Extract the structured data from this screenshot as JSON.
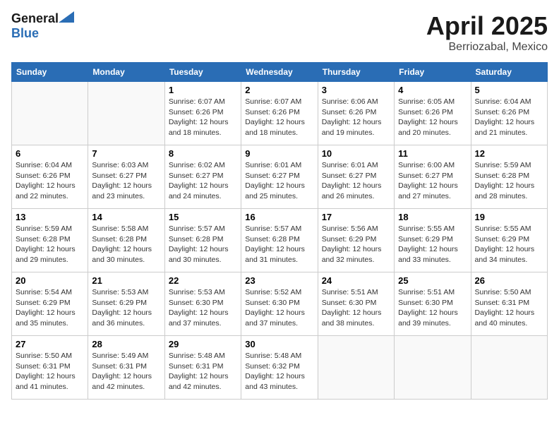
{
  "header": {
    "logo_general": "General",
    "logo_blue": "Blue",
    "title": "April 2025",
    "location": "Berriozabal, Mexico"
  },
  "weekdays": [
    "Sunday",
    "Monday",
    "Tuesday",
    "Wednesday",
    "Thursday",
    "Friday",
    "Saturday"
  ],
  "weeks": [
    [
      {
        "day": "",
        "sunrise": "",
        "sunset": "",
        "daylight": ""
      },
      {
        "day": "",
        "sunrise": "",
        "sunset": "",
        "daylight": ""
      },
      {
        "day": "1",
        "sunrise": "Sunrise: 6:07 AM",
        "sunset": "Sunset: 6:26 PM",
        "daylight": "Daylight: 12 hours and 18 minutes."
      },
      {
        "day": "2",
        "sunrise": "Sunrise: 6:07 AM",
        "sunset": "Sunset: 6:26 PM",
        "daylight": "Daylight: 12 hours and 18 minutes."
      },
      {
        "day": "3",
        "sunrise": "Sunrise: 6:06 AM",
        "sunset": "Sunset: 6:26 PM",
        "daylight": "Daylight: 12 hours and 19 minutes."
      },
      {
        "day": "4",
        "sunrise": "Sunrise: 6:05 AM",
        "sunset": "Sunset: 6:26 PM",
        "daylight": "Daylight: 12 hours and 20 minutes."
      },
      {
        "day": "5",
        "sunrise": "Sunrise: 6:04 AM",
        "sunset": "Sunset: 6:26 PM",
        "daylight": "Daylight: 12 hours and 21 minutes."
      }
    ],
    [
      {
        "day": "6",
        "sunrise": "Sunrise: 6:04 AM",
        "sunset": "Sunset: 6:26 PM",
        "daylight": "Daylight: 12 hours and 22 minutes."
      },
      {
        "day": "7",
        "sunrise": "Sunrise: 6:03 AM",
        "sunset": "Sunset: 6:27 PM",
        "daylight": "Daylight: 12 hours and 23 minutes."
      },
      {
        "day": "8",
        "sunrise": "Sunrise: 6:02 AM",
        "sunset": "Sunset: 6:27 PM",
        "daylight": "Daylight: 12 hours and 24 minutes."
      },
      {
        "day": "9",
        "sunrise": "Sunrise: 6:01 AM",
        "sunset": "Sunset: 6:27 PM",
        "daylight": "Daylight: 12 hours and 25 minutes."
      },
      {
        "day": "10",
        "sunrise": "Sunrise: 6:01 AM",
        "sunset": "Sunset: 6:27 PM",
        "daylight": "Daylight: 12 hours and 26 minutes."
      },
      {
        "day": "11",
        "sunrise": "Sunrise: 6:00 AM",
        "sunset": "Sunset: 6:27 PM",
        "daylight": "Daylight: 12 hours and 27 minutes."
      },
      {
        "day": "12",
        "sunrise": "Sunrise: 5:59 AM",
        "sunset": "Sunset: 6:28 PM",
        "daylight": "Daylight: 12 hours and 28 minutes."
      }
    ],
    [
      {
        "day": "13",
        "sunrise": "Sunrise: 5:59 AM",
        "sunset": "Sunset: 6:28 PM",
        "daylight": "Daylight: 12 hours and 29 minutes."
      },
      {
        "day": "14",
        "sunrise": "Sunrise: 5:58 AM",
        "sunset": "Sunset: 6:28 PM",
        "daylight": "Daylight: 12 hours and 30 minutes."
      },
      {
        "day": "15",
        "sunrise": "Sunrise: 5:57 AM",
        "sunset": "Sunset: 6:28 PM",
        "daylight": "Daylight: 12 hours and 30 minutes."
      },
      {
        "day": "16",
        "sunrise": "Sunrise: 5:57 AM",
        "sunset": "Sunset: 6:28 PM",
        "daylight": "Daylight: 12 hours and 31 minutes."
      },
      {
        "day": "17",
        "sunrise": "Sunrise: 5:56 AM",
        "sunset": "Sunset: 6:29 PM",
        "daylight": "Daylight: 12 hours and 32 minutes."
      },
      {
        "day": "18",
        "sunrise": "Sunrise: 5:55 AM",
        "sunset": "Sunset: 6:29 PM",
        "daylight": "Daylight: 12 hours and 33 minutes."
      },
      {
        "day": "19",
        "sunrise": "Sunrise: 5:55 AM",
        "sunset": "Sunset: 6:29 PM",
        "daylight": "Daylight: 12 hours and 34 minutes."
      }
    ],
    [
      {
        "day": "20",
        "sunrise": "Sunrise: 5:54 AM",
        "sunset": "Sunset: 6:29 PM",
        "daylight": "Daylight: 12 hours and 35 minutes."
      },
      {
        "day": "21",
        "sunrise": "Sunrise: 5:53 AM",
        "sunset": "Sunset: 6:29 PM",
        "daylight": "Daylight: 12 hours and 36 minutes."
      },
      {
        "day": "22",
        "sunrise": "Sunrise: 5:53 AM",
        "sunset": "Sunset: 6:30 PM",
        "daylight": "Daylight: 12 hours and 37 minutes."
      },
      {
        "day": "23",
        "sunrise": "Sunrise: 5:52 AM",
        "sunset": "Sunset: 6:30 PM",
        "daylight": "Daylight: 12 hours and 37 minutes."
      },
      {
        "day": "24",
        "sunrise": "Sunrise: 5:51 AM",
        "sunset": "Sunset: 6:30 PM",
        "daylight": "Daylight: 12 hours and 38 minutes."
      },
      {
        "day": "25",
        "sunrise": "Sunrise: 5:51 AM",
        "sunset": "Sunset: 6:30 PM",
        "daylight": "Daylight: 12 hours and 39 minutes."
      },
      {
        "day": "26",
        "sunrise": "Sunrise: 5:50 AM",
        "sunset": "Sunset: 6:31 PM",
        "daylight": "Daylight: 12 hours and 40 minutes."
      }
    ],
    [
      {
        "day": "27",
        "sunrise": "Sunrise: 5:50 AM",
        "sunset": "Sunset: 6:31 PM",
        "daylight": "Daylight: 12 hours and 41 minutes."
      },
      {
        "day": "28",
        "sunrise": "Sunrise: 5:49 AM",
        "sunset": "Sunset: 6:31 PM",
        "daylight": "Daylight: 12 hours and 42 minutes."
      },
      {
        "day": "29",
        "sunrise": "Sunrise: 5:48 AM",
        "sunset": "Sunset: 6:31 PM",
        "daylight": "Daylight: 12 hours and 42 minutes."
      },
      {
        "day": "30",
        "sunrise": "Sunrise: 5:48 AM",
        "sunset": "Sunset: 6:32 PM",
        "daylight": "Daylight: 12 hours and 43 minutes."
      },
      {
        "day": "",
        "sunrise": "",
        "sunset": "",
        "daylight": ""
      },
      {
        "day": "",
        "sunrise": "",
        "sunset": "",
        "daylight": ""
      },
      {
        "day": "",
        "sunrise": "",
        "sunset": "",
        "daylight": ""
      }
    ]
  ]
}
